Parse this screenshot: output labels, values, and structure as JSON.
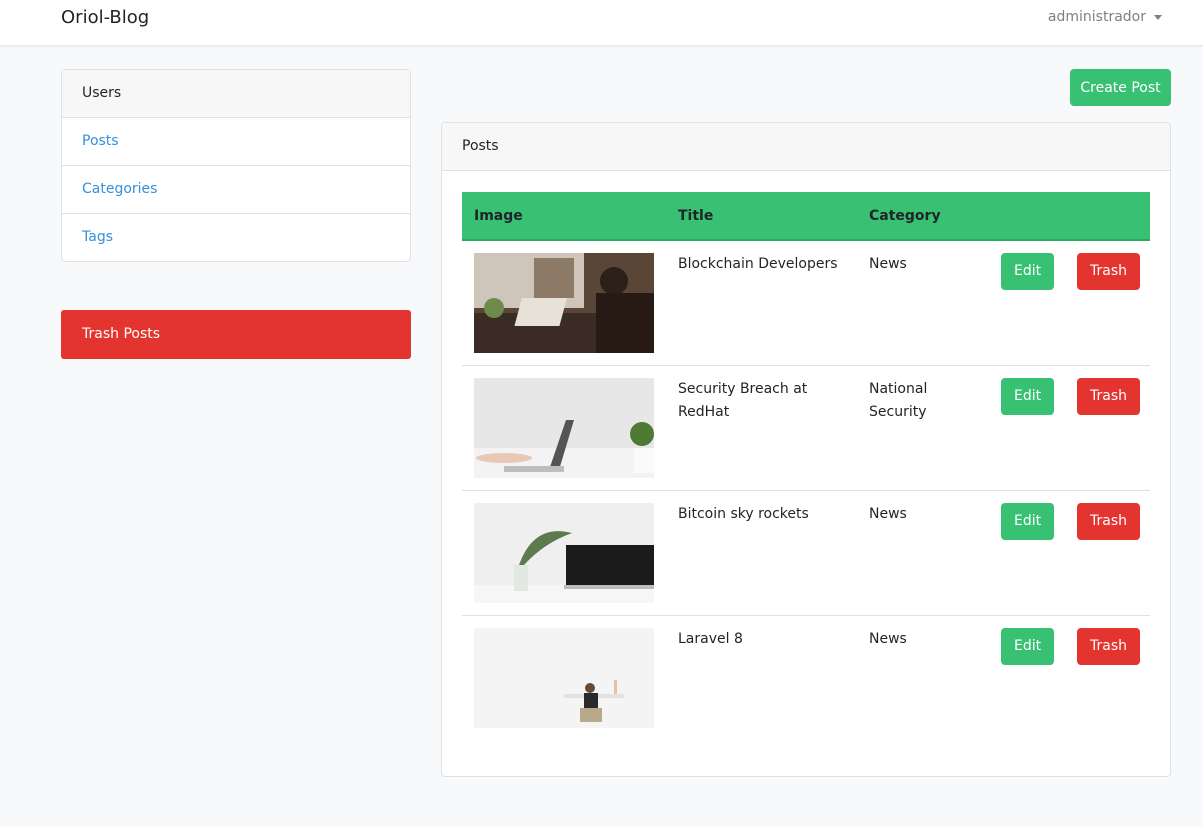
{
  "navbar": {
    "brand": "Oriol-Blog",
    "user": "administrador"
  },
  "sidebar": {
    "items": [
      {
        "label": "Users"
      },
      {
        "label": "Posts"
      },
      {
        "label": "Categories"
      },
      {
        "label": "Tags"
      }
    ],
    "trash_label": "Trash Posts"
  },
  "main": {
    "create_label": "Create Post",
    "card_title": "Posts",
    "columns": [
      "Image",
      "Title",
      "Category"
    ],
    "edit_label": "Edit",
    "trash_label": "Trash",
    "posts": [
      {
        "title": "Blockchain Developers",
        "category": "News"
      },
      {
        "title": "Security Breach at RedHat",
        "category": "National Security"
      },
      {
        "title": "Bitcoin sky rockets",
        "category": "News"
      },
      {
        "title": "Laravel 8",
        "category": "News"
      }
    ]
  },
  "colors": {
    "success": "#38c172",
    "danger": "#e3342f",
    "link": "#3490dc"
  }
}
